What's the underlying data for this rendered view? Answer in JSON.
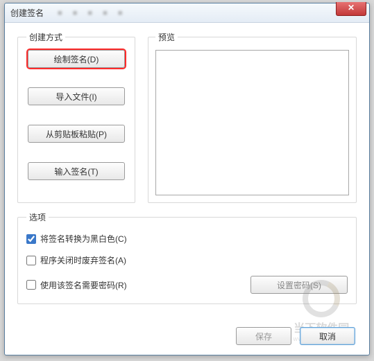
{
  "window": {
    "title": "创建签名"
  },
  "groups": {
    "method_legend": "创建方式",
    "preview_legend": "预览",
    "options_legend": "选项"
  },
  "method_buttons": {
    "draw": "绘制签名(D)",
    "import": "导入文件(I)",
    "paste": "从剪贴板粘贴(P)",
    "type": "输入签名(T)"
  },
  "options": {
    "convert_bw": "将签名转换为黑白色(C)",
    "discard_on_close": "程序关闭时废弃签名(A)",
    "require_password": "使用该签名需要密码(R)",
    "set_password_btn": "设置密码(S)"
  },
  "footer": {
    "save": "保存",
    "cancel": "取消"
  },
  "watermark": {
    "text": "当下软件园",
    "url": "www.downxia.com"
  }
}
